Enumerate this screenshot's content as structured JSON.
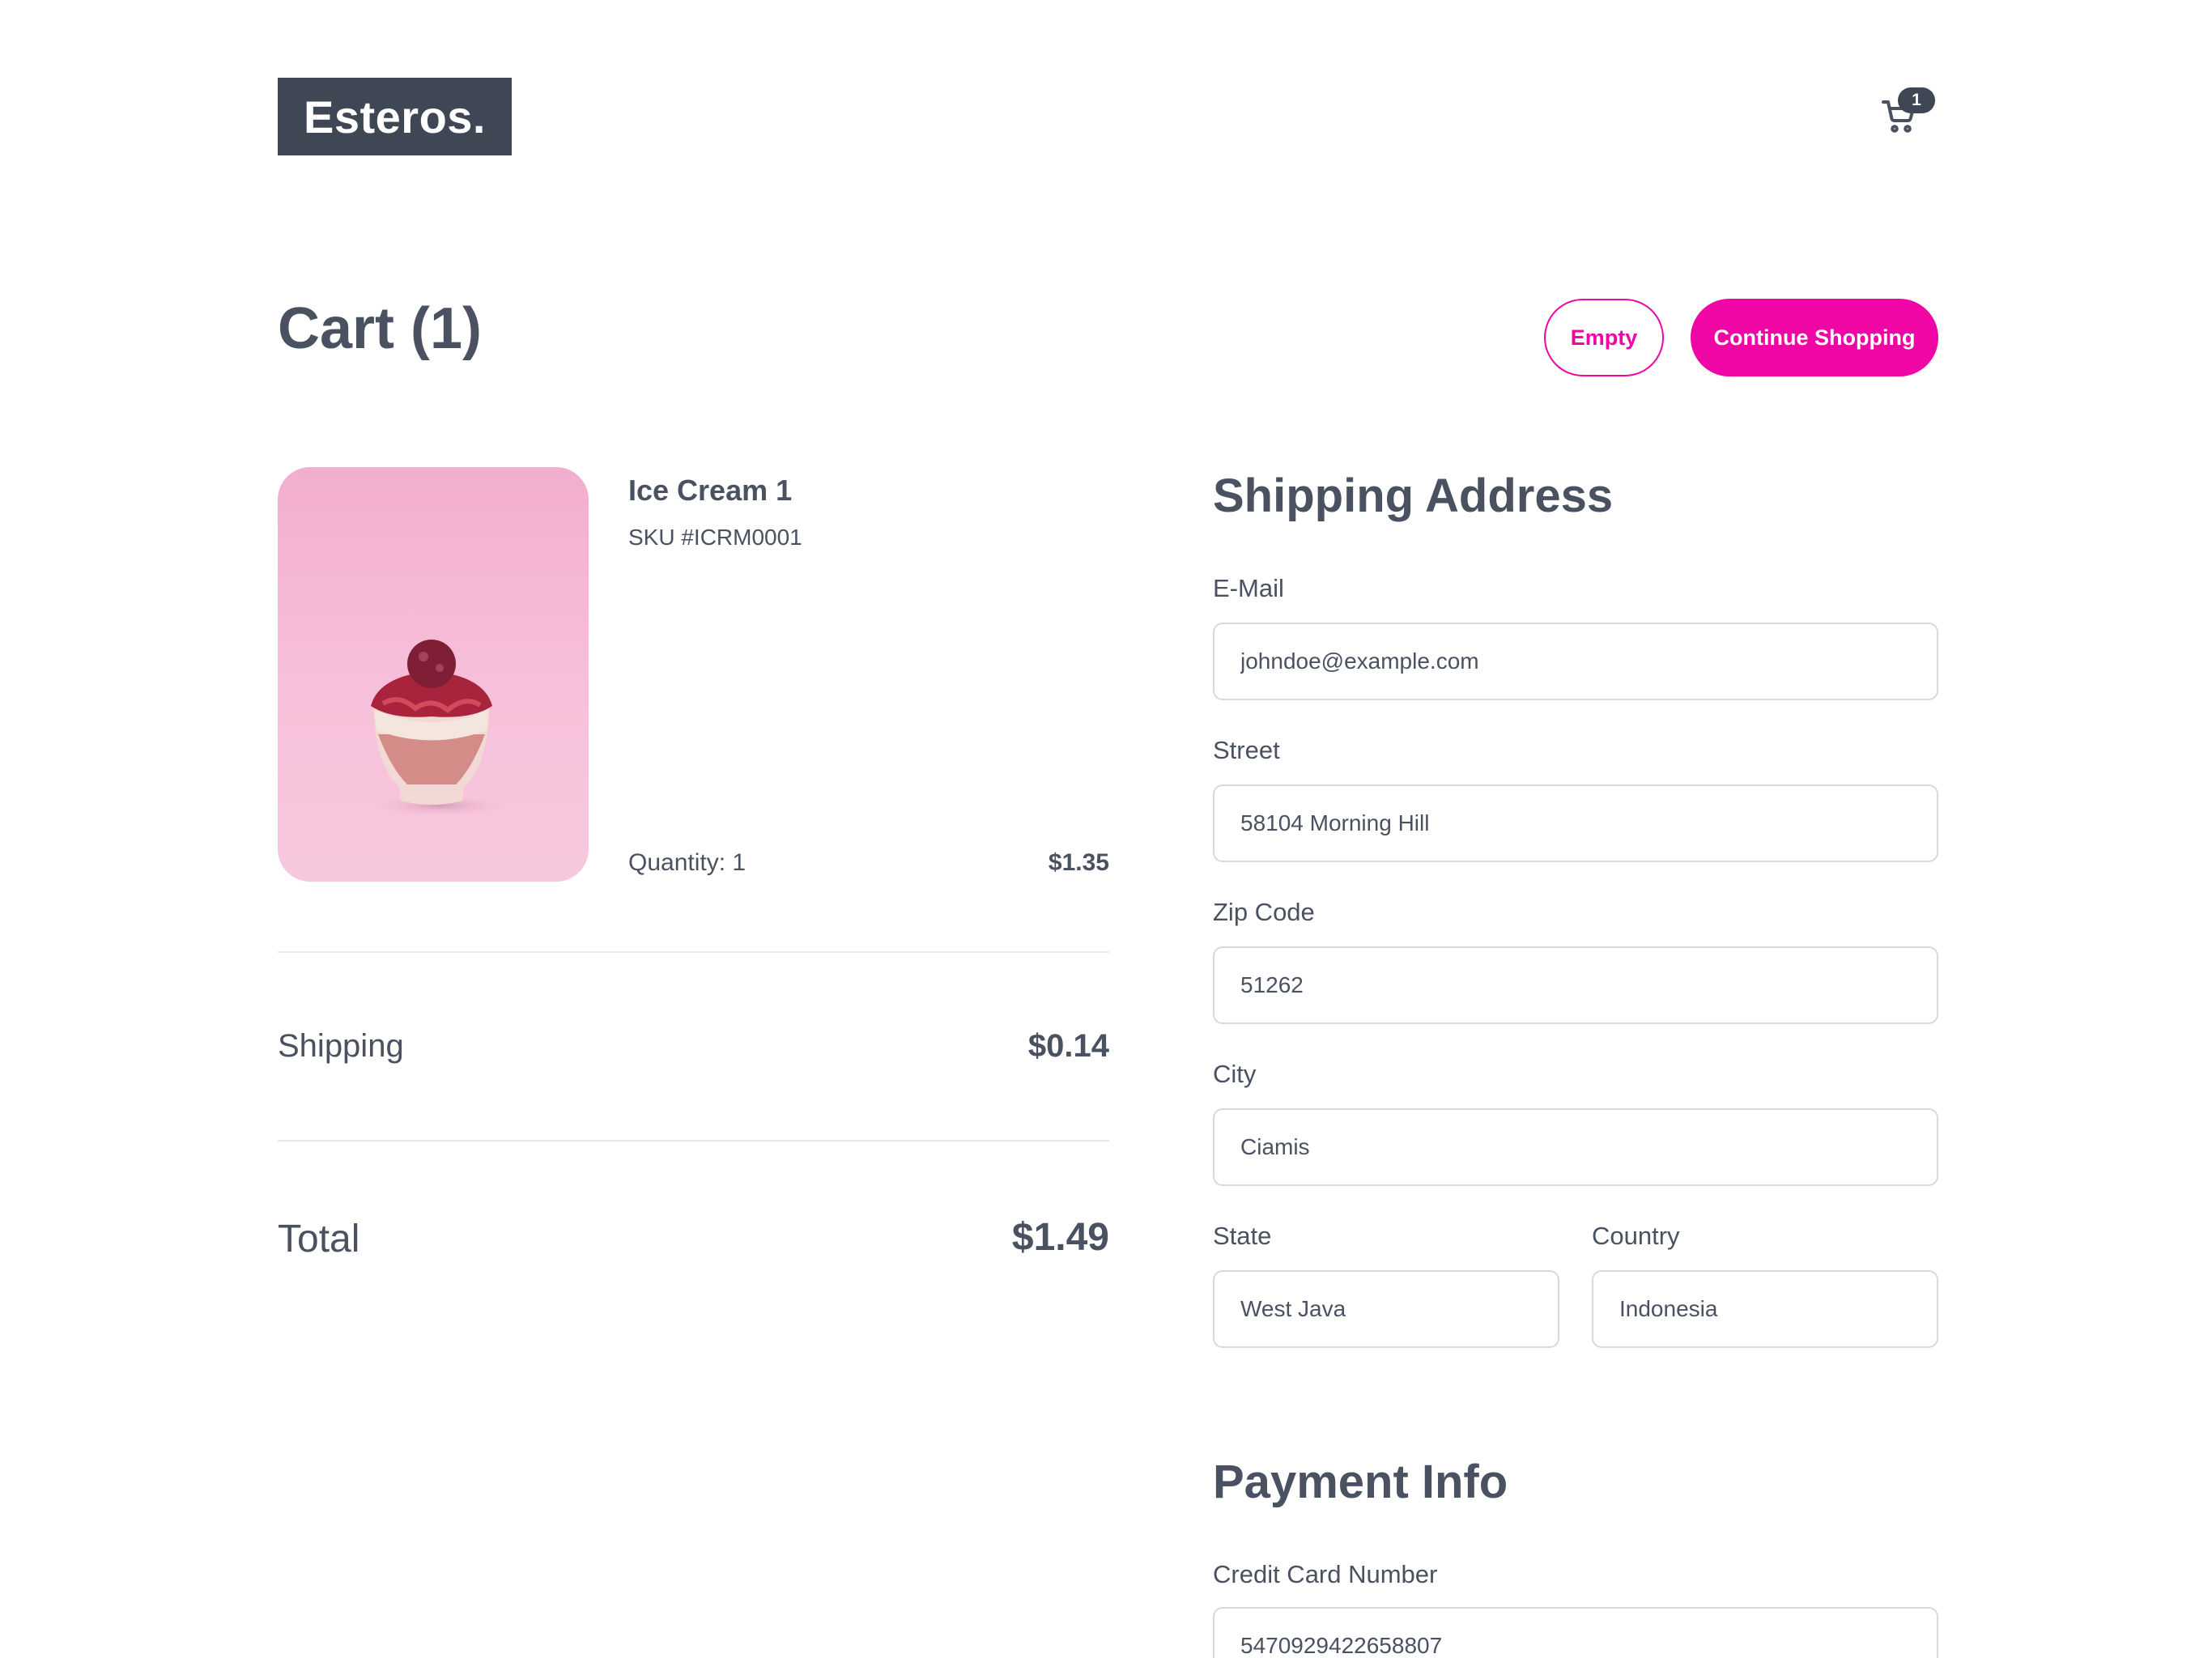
{
  "header": {
    "logo": "Esteros.",
    "cart_count": "1"
  },
  "cart": {
    "title": "Cart (1)",
    "empty_label": "Empty",
    "continue_label": "Continue Shopping"
  },
  "product": {
    "name": "Ice Cream 1",
    "sku": "SKU #ICRM0001",
    "quantity": "Quantity: 1",
    "price": "$1.35"
  },
  "summary": {
    "shipping_label": "Shipping",
    "shipping_value": "$0.14",
    "total_label": "Total",
    "total_value": "$1.49"
  },
  "shipping_address": {
    "title": "Shipping Address",
    "email_label": "E-Mail",
    "email_value": "johndoe@example.com",
    "street_label": "Street",
    "street_value": "58104 Morning Hill",
    "zip_label": "Zip Code",
    "zip_value": "51262",
    "city_label": "City",
    "city_value": "Ciamis",
    "state_label": "State",
    "state_value": "West Java",
    "country_label": "Country",
    "country_value": "Indonesia"
  },
  "payment": {
    "title": "Payment Info",
    "card_label": "Credit Card Number",
    "card_value": "5470929422658807"
  },
  "colors": {
    "accent": "#ef06a4",
    "text": "#4a5160",
    "dark": "#3f4654"
  },
  "icons": {
    "cart": "shopping-cart-icon"
  }
}
